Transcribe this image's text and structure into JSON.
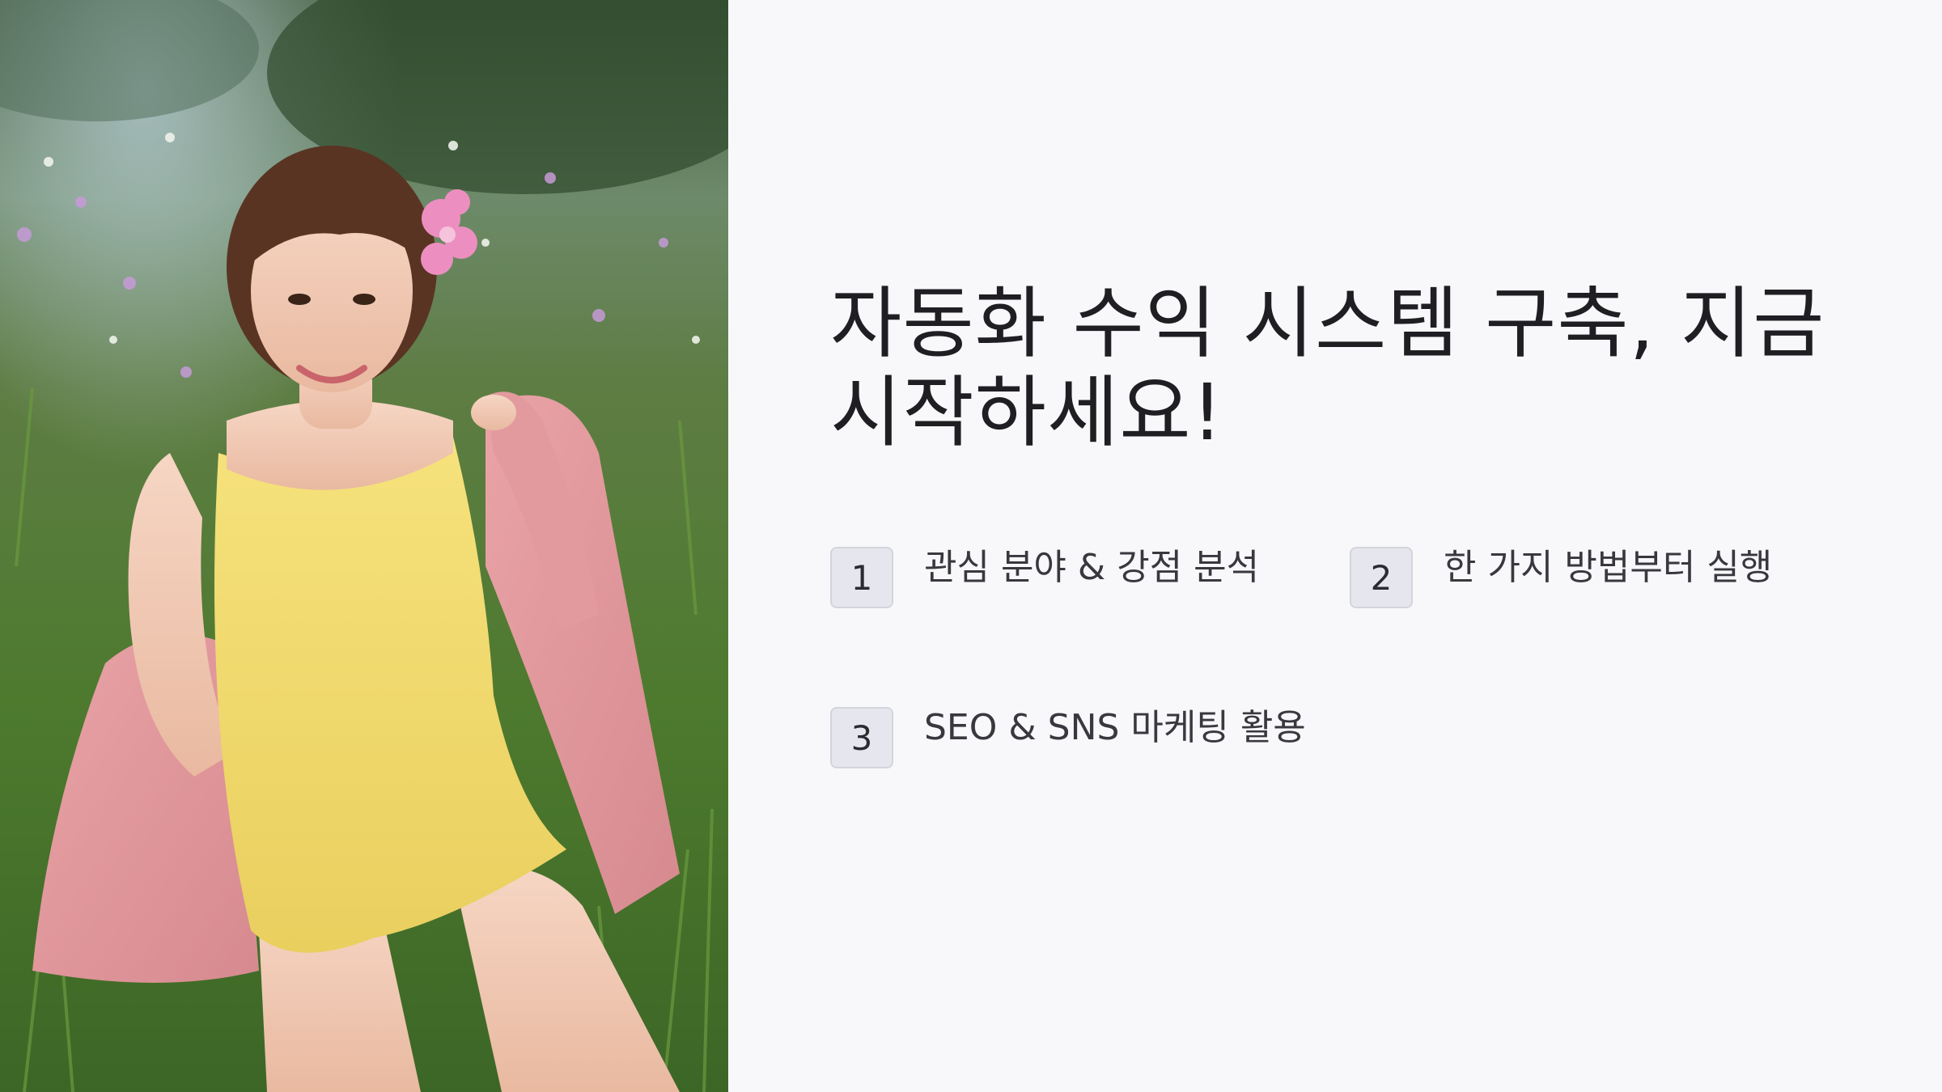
{
  "title": "자동화 수익 시스템 구축, 지금 시작하세요!",
  "photo": {
    "icon": "person-photo"
  },
  "steps": [
    {
      "number": "1",
      "label": "관심 분야 & 강점 분석"
    },
    {
      "number": "2",
      "label": "한 가지 방법부터 실행"
    },
    {
      "number": "3",
      "label": "SEO & SNS 마케팅 활용"
    }
  ],
  "colors": {
    "background": "#f8f8fb",
    "title": "#1f1f23",
    "badge_bg": "#e6e7ee",
    "badge_border": "#d4d5dc",
    "step_text": "#38383e"
  }
}
